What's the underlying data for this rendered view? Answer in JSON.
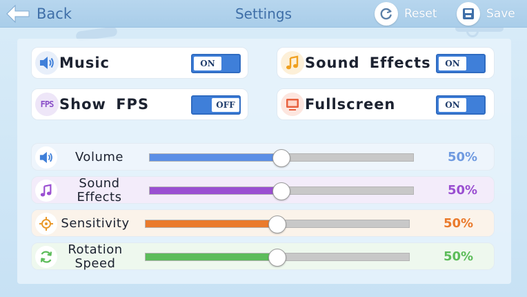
{
  "header": {
    "back_label": "Back",
    "title": "Settings",
    "reset_label": "Reset",
    "save_label": "Save"
  },
  "toggles": [
    {
      "label": "Music",
      "state": "ON",
      "icon": "speaker-icon"
    },
    {
      "label": "Sound Effects",
      "state": "ON",
      "icon": "music-note-icon"
    },
    {
      "label": "Show FPS",
      "state": "OFF",
      "icon": "fps-icon",
      "icon_text": "FPS"
    },
    {
      "label": "Fullscreen",
      "state": "ON",
      "icon": "monitor-icon"
    }
  ],
  "sliders": [
    {
      "label": "Volume",
      "value": 50,
      "value_text": "50%",
      "icon": "speaker-icon",
      "color": "#5b8fe6",
      "text_color": "#6f9ae0",
      "bg": "#eef5fc"
    },
    {
      "label": "Sound Effects",
      "value": 50,
      "value_text": "50%",
      "icon": "music-note-icon",
      "color": "#9a4fd1",
      "text_color": "#9a4fd1",
      "bg": "#f3ecfa"
    },
    {
      "label": "Sensitivity",
      "value": 50,
      "value_text": "50%",
      "icon": "target-icon",
      "color": "#ea7a2c",
      "text_color": "#ea7a2c",
      "bg": "#fbf3ea"
    },
    {
      "label": "Rotation Speed",
      "value": 50,
      "value_text": "50%",
      "icon": "refresh-icon",
      "color": "#5cbc5a",
      "text_color": "#5cbc5a",
      "bg": "#eef8ee"
    }
  ],
  "colors": {
    "accent": "#3f7fd9",
    "title_text": "#3f6fa8"
  }
}
